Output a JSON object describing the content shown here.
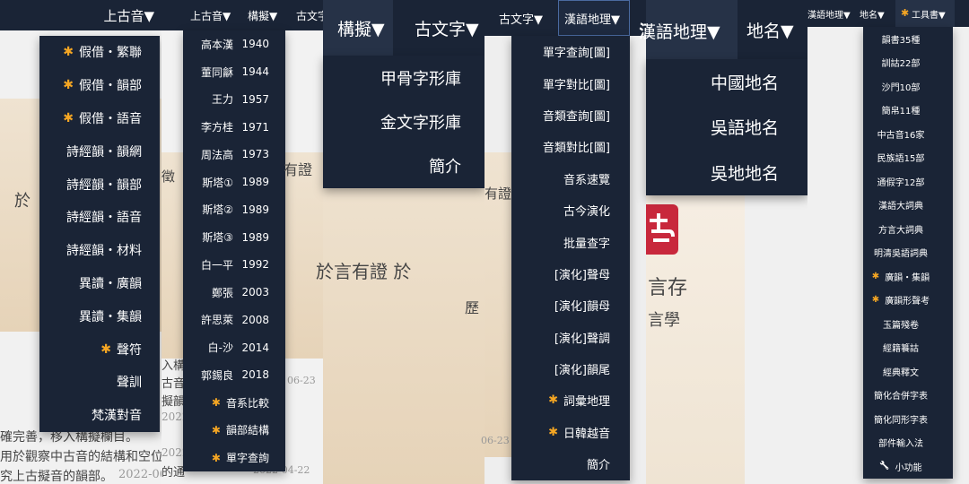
{
  "panel1": {
    "header": "上古音▼",
    "items": [
      {
        "label": "假借・繁聯",
        "star": true
      },
      {
        "label": "假借・韻部",
        "star": true
      },
      {
        "label": "假借・語音",
        "star": true
      },
      {
        "label": "詩經韻・韻網",
        "star": false
      },
      {
        "label": "詩經韻・韻部",
        "star": false
      },
      {
        "label": "詩經韻・語音",
        "star": false
      },
      {
        "label": "詩經韻・材料",
        "star": false
      },
      {
        "label": "異讀・廣韻",
        "star": false
      },
      {
        "label": "異讀・集韻",
        "star": false
      },
      {
        "label": "聲符",
        "star": true
      },
      {
        "label": "聲訓",
        "star": false
      },
      {
        "label": "梵漢對音",
        "star": false
      }
    ],
    "bg_lines": [
      "於",
      "確完善，移入構擬欄目。",
      "用於觀察中古音的結構和空位",
      "究上古擬音的韻部。",
      "2022-06"
    ]
  },
  "panel2": {
    "header": {
      "a": "上古音▼",
      "b": "構擬▼",
      "c": "古文字"
    },
    "items": [
      {
        "label": "高本漢",
        "year": "1940",
        "star": false
      },
      {
        "label": "董同龢",
        "year": "1944",
        "star": false
      },
      {
        "label": "王力",
        "year": "1957",
        "star": false
      },
      {
        "label": "李方桂",
        "year": "1971",
        "star": false
      },
      {
        "label": "周法高",
        "year": "1973",
        "star": false
      },
      {
        "label": "斯塔①",
        "year": "1989",
        "star": false
      },
      {
        "label": "斯塔②",
        "year": "1989",
        "star": false
      },
      {
        "label": "斯塔③",
        "year": "1989",
        "star": false
      },
      {
        "label": "白一平",
        "year": "1992",
        "star": false
      },
      {
        "label": "鄭張",
        "year": "2003",
        "star": false
      },
      {
        "label": "許思萊",
        "year": "2008",
        "star": false
      },
      {
        "label": "白-沙",
        "year": "2014",
        "star": false
      },
      {
        "label": "郭錫良",
        "year": "2018",
        "star": false
      },
      {
        "label": "音系比較",
        "year": "",
        "star": true
      },
      {
        "label": "韻部結構",
        "year": "",
        "star": true
      },
      {
        "label": "單字查詢",
        "year": "",
        "star": true
      }
    ],
    "bg_lines": [
      "入構擬",
      "古音的",
      "擬韻部",
      "2022-",
      "使用",
      "2022-",
      "的通",
      "2022-04-22",
      "06-23"
    ]
  },
  "panel3": {
    "header": {
      "a": "構擬▼",
      "b": "古文字▼"
    },
    "items": [
      "甲骨字形庫",
      "金文字形庫",
      "簡介"
    ],
    "bg_lines": [
      "徵",
      "有證",
      "於言有證 於",
      "歷"
    ]
  },
  "panel4": {
    "header": {
      "a": "古文字▼",
      "b": "漢語地理▼"
    },
    "items": [
      {
        "label": "單字查詢[圖]",
        "star": false
      },
      {
        "label": "單字對比[圖]",
        "star": false
      },
      {
        "label": "音類查詢[圖]",
        "star": false
      },
      {
        "label": "音類對比[圖]",
        "star": false
      },
      {
        "label": "音系速覽",
        "star": false
      },
      {
        "label": "古今演化",
        "star": false
      },
      {
        "label": "批量查字",
        "star": false
      },
      {
        "label": "[演化]聲母",
        "star": false
      },
      {
        "label": "[演化]韻母",
        "star": false
      },
      {
        "label": "[演化]聲調",
        "star": false
      },
      {
        "label": "[演化]韻尾",
        "star": false
      },
      {
        "label": "詞彙地理",
        "star": true
      },
      {
        "label": "日韓越音",
        "star": true
      },
      {
        "label": "簡介",
        "star": false
      }
    ],
    "bg_lines": [
      "有證",
      "06-23"
    ]
  },
  "panel5": {
    "header": {
      "a": "漢語地理▼",
      "b": "地名▼"
    },
    "items": [
      "中國地名",
      "吳語地名",
      "吳地地名"
    ],
    "bg_lines": [
      "言存",
      "言學"
    ]
  },
  "panel6": {
    "header": {
      "a": "漢語地理▼",
      "b": "地名▼",
      "c": "工具書▼"
    },
    "items": [
      {
        "label": "韻書35種",
        "star": false
      },
      {
        "label": "訓詁22部",
        "star": false
      },
      {
        "label": "沙門10部",
        "star": false
      },
      {
        "label": "簡帛11種",
        "star": false
      },
      {
        "label": "中古音16家",
        "star": false
      },
      {
        "label": "民族語15部",
        "star": false
      },
      {
        "label": "通假字12部",
        "star": false
      },
      {
        "label": "漢語大詞典",
        "star": false
      },
      {
        "label": "方言大詞典",
        "star": false
      },
      {
        "label": "明清吳語詞典",
        "star": false
      },
      {
        "label": "廣韻・集韻",
        "star": true
      },
      {
        "label": "廣韻形聲考",
        "star": true
      },
      {
        "label": "玉篇殘卷",
        "star": false
      },
      {
        "label": "經籍籑詁",
        "star": false
      },
      {
        "label": "經典釋文",
        "star": false
      },
      {
        "label": "簡化合併字表",
        "star": false
      },
      {
        "label": "簡化同形字表",
        "star": false
      },
      {
        "label": "部件輸入法",
        "star": false
      },
      {
        "label": "小功能",
        "star": false
      }
    ]
  },
  "colors": {
    "navy": "#1a2436",
    "star": "#f5a623",
    "logo": "#c8283c"
  }
}
